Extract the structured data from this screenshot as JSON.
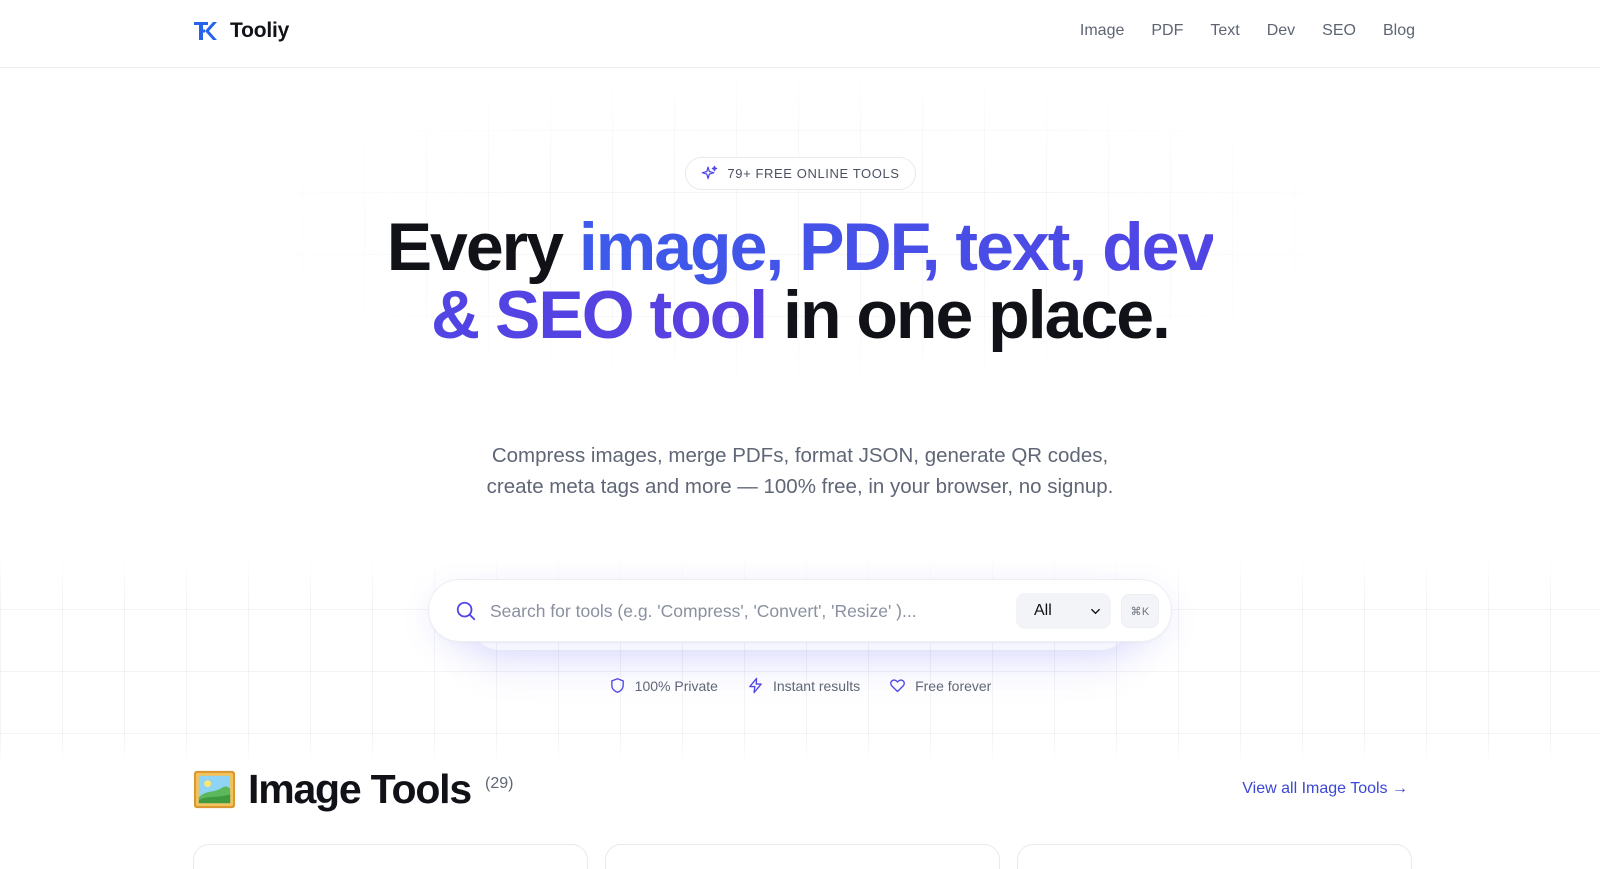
{
  "header": {
    "brand": "Tooliy",
    "nav": [
      "Image",
      "PDF",
      "Text",
      "Dev",
      "SEO",
      "Blog"
    ]
  },
  "hero": {
    "badge": "79+ FREE ONLINE TOOLS",
    "headline": {
      "lead": "Every ",
      "accent": "image, PDF, text, dev & SEO tool",
      "trail": " in one place."
    },
    "subtitle": "Compress images, merge PDFs, format JSON, generate QR codes, create meta tags and more — 100% free, in your browser, no signup."
  },
  "search": {
    "placeholder": "Search for tools (e.g. 'Compress', 'Convert', 'Resize' )...",
    "value": "",
    "filter_selected": "All",
    "shortcut": "⌘K"
  },
  "features": [
    {
      "icon": "shield-icon",
      "label": "100% Private"
    },
    {
      "icon": "lightning-icon",
      "label": "Instant results"
    },
    {
      "icon": "heart-icon",
      "label": "Free forever"
    }
  ],
  "section": {
    "emoji": "framed-picture-icon",
    "title": "Image Tools",
    "count": "(29)",
    "view_all": "View all Image Tools →"
  },
  "colors": {
    "accent": "#4f46e5",
    "accent_blue": "#3d5bea",
    "link": "#3b47d6",
    "text": "#111217",
    "muted": "#5f6675"
  }
}
